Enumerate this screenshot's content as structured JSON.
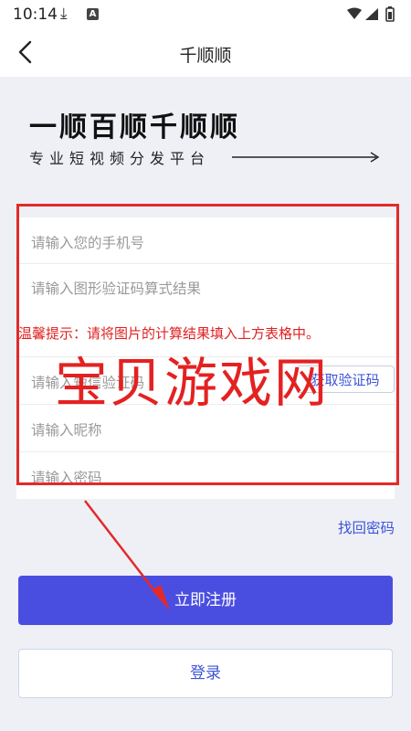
{
  "status_bar": {
    "time": "10:14"
  },
  "header": {
    "title": "千顺顺"
  },
  "hero": {
    "brand": "一顺百顺千顺顺",
    "slogan": "专业短视频分发平台"
  },
  "form": {
    "phone_placeholder": "请输入您的手机号",
    "captcha_placeholder": "请输入图形验证码算式结果",
    "captcha_tip": "温馨提示：请将图片的计算结果填入上方表格中。",
    "sms_placeholder": "请输入短信验证码",
    "sms_button": "获取验证码",
    "nickname_placeholder": "请输入昵称",
    "password_placeholder": "请输入密码"
  },
  "watermark": "宝贝游戏网",
  "links": {
    "forgot_password": "找回密码"
  },
  "buttons": {
    "register": "立即注册",
    "login": "登录"
  },
  "colors": {
    "accent": "#4a4ee0",
    "link": "#3d54d8",
    "annotation_red": "#e22a2a"
  }
}
